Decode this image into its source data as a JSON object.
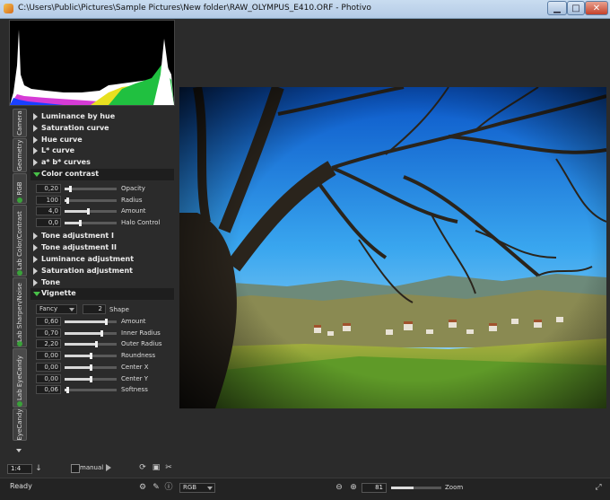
{
  "window": {
    "title": "C:\\Users\\Public\\Pictures\\Sample Pictures\\New folder\\RAW_OLYMPUS_E410.ORF - Photivo",
    "min_label": "▁",
    "max_label": "□",
    "close_label": "✕"
  },
  "tabs": [
    {
      "label": "Camera"
    },
    {
      "label": "Geometry"
    },
    {
      "label": "RGB"
    },
    {
      "label": "Lab Color/Contrast"
    },
    {
      "label": "Lab Sharpen/Noise"
    },
    {
      "label": "Lab EyeCandy"
    },
    {
      "label": "EyeCandy"
    }
  ],
  "sections": {
    "luminance_by_hue": "Luminance by hue",
    "saturation_curve": "Saturation curve",
    "hue_curve": "Hue curve",
    "l_curve": "L* curve",
    "ab_curves": "a* b* curves",
    "color_contrast": "Color contrast",
    "tone_adj_1": "Tone adjustment I",
    "tone_adj_2": "Tone adjustment II",
    "luminance_adj": "Luminance adjustment",
    "saturation_adj": "Saturation adjustment",
    "tone": "Tone",
    "vignette": "Vignette"
  },
  "color_contrast": [
    {
      "value": "0,20",
      "label": "Opacity",
      "level": 0.1
    },
    {
      "value": "100",
      "label": "Radius",
      "level": 0.05
    },
    {
      "value": "4,0",
      "label": "Amount",
      "level": 0.45
    },
    {
      "value": "0,0",
      "label": "Halo Control",
      "level": 0.3
    }
  ],
  "vignette": {
    "mode": "Fancy",
    "shape_value": "2",
    "shape_label": "Shape",
    "rows": [
      {
        "value": "0,60",
        "label": "Amount",
        "level": 0.8
      },
      {
        "value": "0,70",
        "label": "Inner Radius",
        "level": 0.7
      },
      {
        "value": "2,20",
        "label": "Outer Radius",
        "level": 0.6
      },
      {
        "value": "0,00",
        "label": "Roundness",
        "level": 0.5
      },
      {
        "value": "0,00",
        "label": "Center X",
        "level": 0.5
      },
      {
        "value": "0,00",
        "label": "Center Y",
        "level": 0.5
      },
      {
        "value": "0,06",
        "label": "Softness",
        "level": 0.05
      }
    ]
  },
  "bottom": {
    "zoom_fit": "1:4",
    "manual_label": "manual",
    "status": "Ready",
    "channel": "RGB",
    "zoom_value": "81",
    "zoom_label": "Zoom"
  }
}
